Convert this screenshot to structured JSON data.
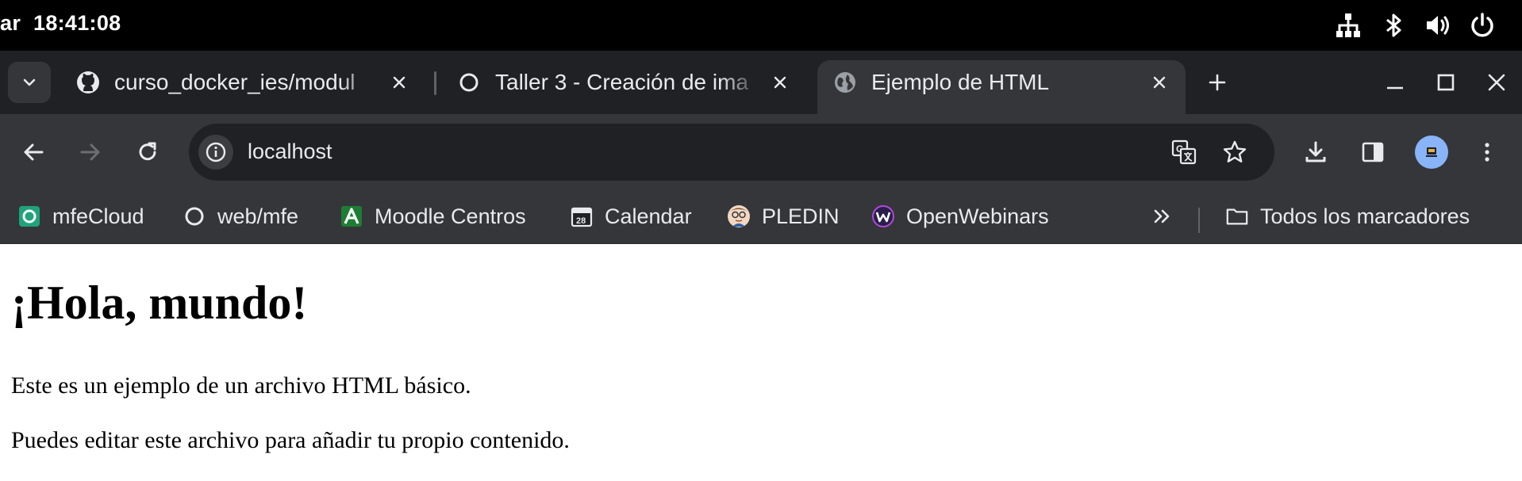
{
  "system_bar": {
    "date_fragment": "ar",
    "time": "18:41:08",
    "icons": [
      "network-icon",
      "bluetooth-icon",
      "volume-icon",
      "power-icon"
    ]
  },
  "tabs": [
    {
      "title": "curso_docker_ies/modul",
      "icon": "github-icon",
      "active": false
    },
    {
      "title": "Taller 3 - Creación de ima",
      "icon": "circle-icon",
      "active": false
    },
    {
      "title": "Ejemplo de HTML",
      "icon": "globe-icon",
      "active": true
    }
  ],
  "omnibox": {
    "url": "localhost"
  },
  "bookmarks": [
    {
      "label": "mfeCloud",
      "icon": "mfecloud-icon"
    },
    {
      "label": "web/mfe",
      "icon": "circle-icon"
    },
    {
      "label": "Moodle Centros",
      "icon": "moodle-icon"
    },
    {
      "label": "Calendar",
      "icon": "calendar-icon"
    },
    {
      "label": "PLEDIN",
      "icon": "pledin-icon"
    },
    {
      "label": "OpenWebinars",
      "icon": "openwebinars-icon"
    }
  ],
  "all_bookmarks_label": "Todos los marcadores",
  "colors": {
    "frame": "#202124",
    "toolbar": "#35363a",
    "text": "#e8eaed",
    "avatar": "#8ab4f8"
  },
  "page": {
    "heading": "¡Hola, mundo!",
    "paragraph1": "Este es un ejemplo de un archivo HTML básico.",
    "paragraph2": "Puedes editar este archivo para añadir tu propio contenido."
  }
}
